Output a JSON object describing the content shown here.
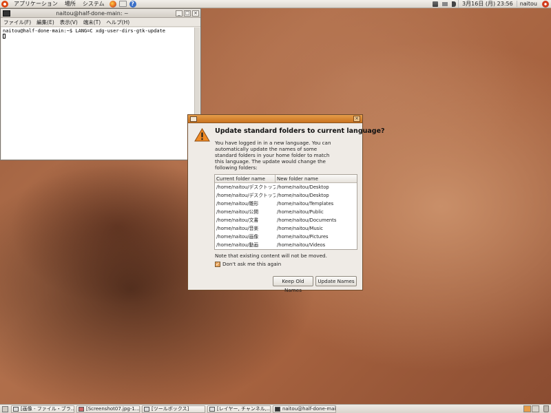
{
  "top_panel": {
    "menus": [
      "アプリケーション",
      "場所",
      "システム"
    ],
    "launchers": [
      "firefox-icon",
      "mail-icon",
      "help-icon"
    ],
    "clock": "3月16日 (月) 23:56",
    "user": "naitou"
  },
  "terminal": {
    "title": "naitou@half-done-main: ~",
    "menus": [
      "ファイル(F)",
      "編集(E)",
      "表示(V)",
      "端末(T)",
      "ヘルプ(H)"
    ],
    "prompt_line": "naitou@half-done-main:~$ LANG=C xdg-user-dirs-gtk-update"
  },
  "dialog": {
    "heading": "Update standard folders to current language?",
    "description": "You have logged in in a new language. You can automatically update the names of some standard folders in your home folder to match this language. The update would change the following folders:",
    "table": {
      "headers": [
        "Current folder name",
        "New folder name"
      ],
      "rows": [
        [
          "/home/naitou/デスクトップ",
          "/home/naitou/Desktop"
        ],
        [
          "/home/naitou/デスクトップ",
          "/home/naitou/Desktop"
        ],
        [
          "/home/naitou/雛形",
          "/home/naitou/Templates"
        ],
        [
          "/home/naitou/公開",
          "/home/naitou/Public"
        ],
        [
          "/home/naitou/文書",
          "/home/naitou/Documents"
        ],
        [
          "/home/naitou/音楽",
          "/home/naitou/Music"
        ],
        [
          "/home/naitou/画像",
          "/home/naitou/Pictures"
        ],
        [
          "/home/naitou/動画",
          "/home/naitou/Videos"
        ]
      ]
    },
    "note": "Note that existing content will not be moved.",
    "checkbox_label": "Don't ask me this again",
    "checkbox_checked": true,
    "keep_button": "Keep Old Names",
    "update_button": "Update Names"
  },
  "taskbar": {
    "tasks": [
      {
        "label": "[画像 - ファイル・ブラ…",
        "icon": "folder-icon"
      },
      {
        "label": "[Screenshot07.jpg-1.…",
        "icon": "image-icon"
      },
      {
        "label": "[ツールボックス]",
        "icon": "toolbox-icon"
      },
      {
        "label": "[レイヤー, チャンネル,…",
        "icon": "layers-icon"
      },
      {
        "label": "naitou@half-done-mai…",
        "icon": "terminal-icon"
      }
    ]
  },
  "colors": {
    "accent": "#e59d4a",
    "wallpaper": "#a6623f"
  }
}
